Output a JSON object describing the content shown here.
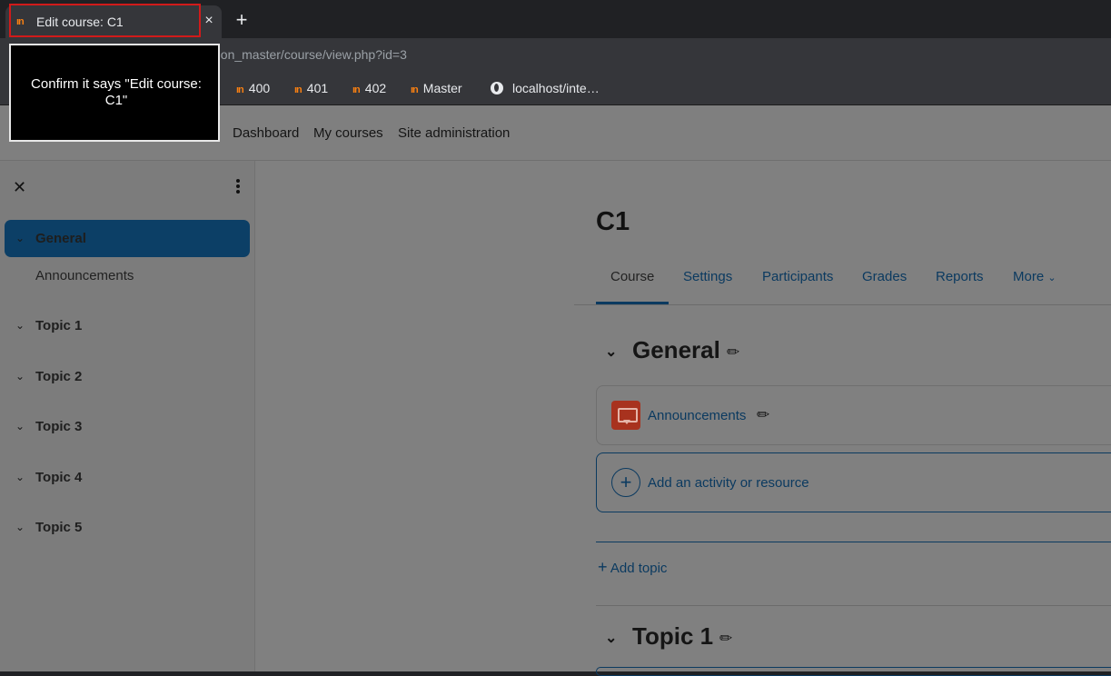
{
  "browser": {
    "tab": {
      "title": "Edit course: C1",
      "favicon": "moodle-icon",
      "close": "×"
    },
    "new_tab": "+",
    "url": "ation_master/course/view.php?id=3",
    "bookmarks": [
      {
        "label": "400",
        "icon": "moodle-icon"
      },
      {
        "label": "401",
        "icon": "moodle-icon"
      },
      {
        "label": "402",
        "icon": "moodle-icon"
      },
      {
        "label": "Master",
        "icon": "moodle-icon"
      },
      {
        "label": "localhost/inte…",
        "icon": "globe-icon"
      }
    ]
  },
  "overlay": {
    "text": "Confirm it says \"Edit course: C1\""
  },
  "navbar": {
    "items": [
      "Dashboard",
      "My courses",
      "Site administration"
    ]
  },
  "drawer": {
    "close": "✕",
    "sections": [
      {
        "label": "General",
        "active": true,
        "children": [
          "Announcements"
        ]
      },
      {
        "label": "Topic 1"
      },
      {
        "label": "Topic 2"
      },
      {
        "label": "Topic 3"
      },
      {
        "label": "Topic 4"
      },
      {
        "label": "Topic 5"
      }
    ]
  },
  "course": {
    "title": "C1",
    "tabs": [
      {
        "label": "Course",
        "active": true
      },
      {
        "label": "Settings"
      },
      {
        "label": "Participants"
      },
      {
        "label": "Grades"
      },
      {
        "label": "Reports"
      },
      {
        "label": "More"
      }
    ],
    "sections": [
      {
        "title": "General",
        "activities": [
          {
            "label": "Announcements",
            "icon": "forum-icon"
          }
        ]
      },
      {
        "title": "Topic 1"
      }
    ],
    "add_activity": "Add an activity or resource",
    "add_topic": "Add topic"
  },
  "colors": {
    "accent": "#0b3a60",
    "highlight": "#d11a1a",
    "brand": "#f98012"
  }
}
